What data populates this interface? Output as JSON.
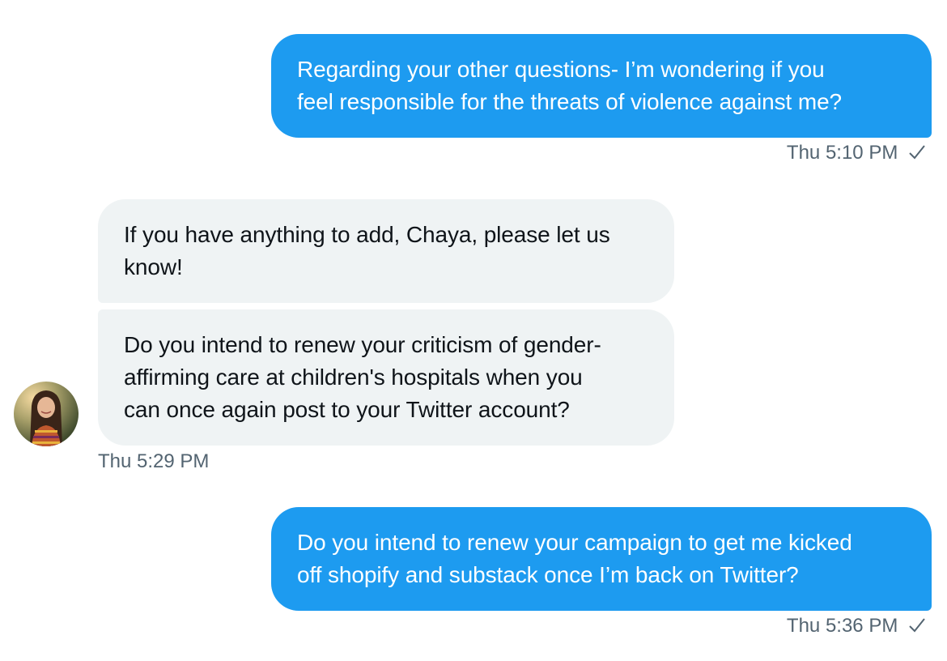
{
  "messages": [
    {
      "lines": [
        "Regarding your other questions- I’m wondering if you",
        "feel responsible for the threats of violence against me?"
      ],
      "time": "Thu 5:10 PM"
    },
    {
      "lines": [
        "If you have anything to add, Chaya, please let us",
        "know!"
      ]
    },
    {
      "lines": [
        "Do you intend to renew your criticism of gender-",
        "affirming care at children's hospitals when you",
        "can once again post to your Twitter account?"
      ],
      "time": "Thu 5:29 PM"
    },
    {
      "lines": [
        "Do you intend to renew your campaign to get me kicked",
        "off shopify and substack once I’m back on Twitter?"
      ],
      "time": "Thu 5:36 PM"
    }
  ],
  "icons": {
    "read_receipt": "checkmark-icon",
    "avatar": "user-avatar"
  },
  "colors": {
    "sent_bubble": "#1d9bf0",
    "received_bubble": "#eff3f4",
    "timestamp": "#536471",
    "text_dark": "#0f1419"
  }
}
